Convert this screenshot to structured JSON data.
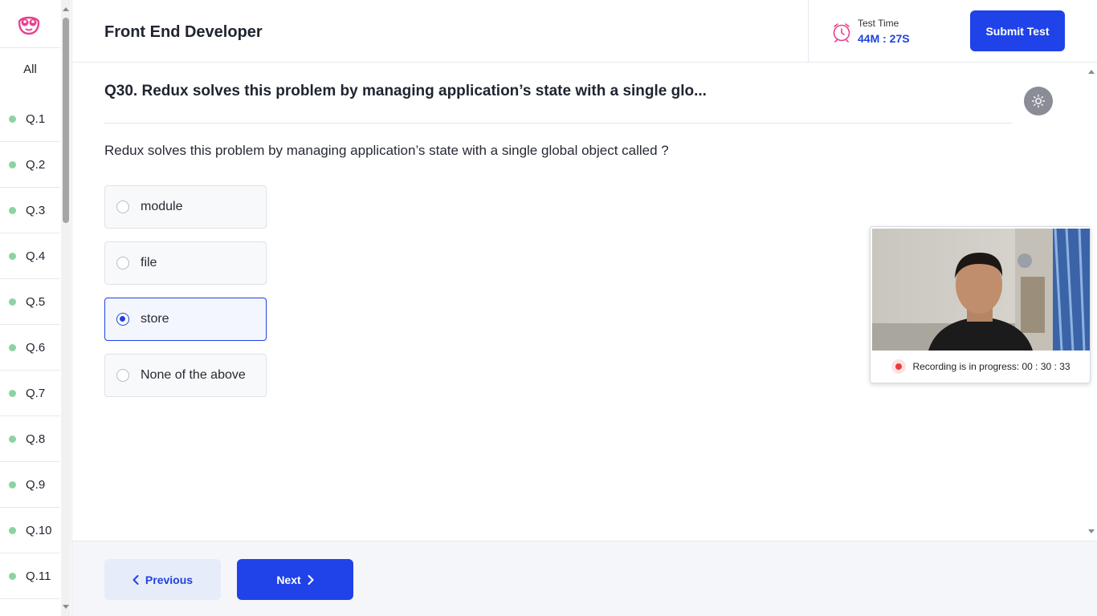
{
  "sidebar": {
    "all_label": "All",
    "questions": [
      {
        "label": "Q.1"
      },
      {
        "label": "Q.2"
      },
      {
        "label": "Q.3"
      },
      {
        "label": "Q.4"
      },
      {
        "label": "Q.5"
      },
      {
        "label": "Q.6"
      },
      {
        "label": "Q.7"
      },
      {
        "label": "Q.8"
      },
      {
        "label": "Q.9"
      },
      {
        "label": "Q.10"
      },
      {
        "label": "Q.11"
      }
    ],
    "dot_color": "#8bd3a3"
  },
  "header": {
    "title": "Front End Developer",
    "timer_label": "Test Time",
    "timer_value": "44M : 27S",
    "submit_label": "Submit Test"
  },
  "question": {
    "title": "Q30. Redux solves this problem by managing application’s state with a single glo...",
    "text": "Redux solves this problem by managing application’s state with a single global object called ?",
    "options": [
      {
        "label": "module",
        "selected": false
      },
      {
        "label": "file",
        "selected": false
      },
      {
        "label": "store",
        "selected": true
      },
      {
        "label": "None of the above",
        "selected": false
      }
    ]
  },
  "footer": {
    "prev_label": "Previous",
    "next_label": "Next"
  },
  "webcam": {
    "recording_text": "Recording is in progress: 00 : 30 : 33"
  },
  "colors": {
    "accent": "#1f43e8",
    "record": "#ee3a3a",
    "logo": "#e8408f"
  }
}
